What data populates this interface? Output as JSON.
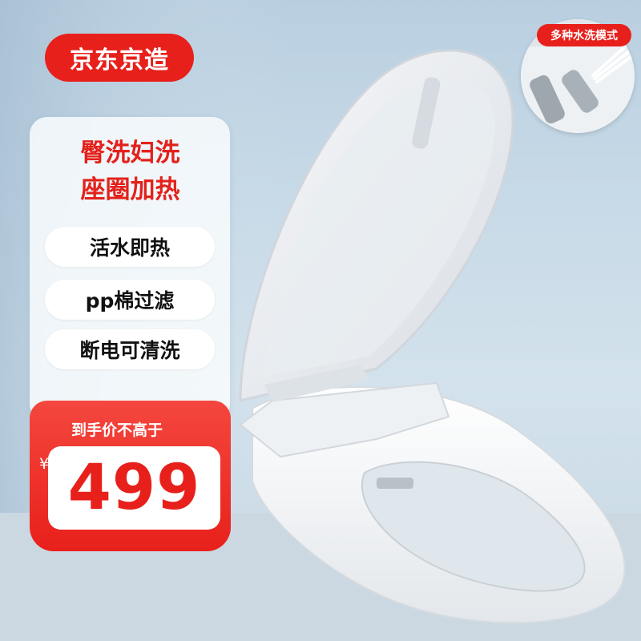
{
  "brand": {
    "label": "京东京造",
    "color": "#e8201b"
  },
  "headline": {
    "line1": "臀洗妇洗",
    "line2": "座圈加热"
  },
  "features": [
    "活水即热",
    "pp棉过滤",
    "断电可清洗"
  ],
  "price": {
    "caption": "到手价不高于",
    "currency": "¥",
    "value": "499"
  },
  "inset": {
    "label": "多种水洗模式"
  },
  "product": {
    "name": "smart-toilet-seat"
  }
}
